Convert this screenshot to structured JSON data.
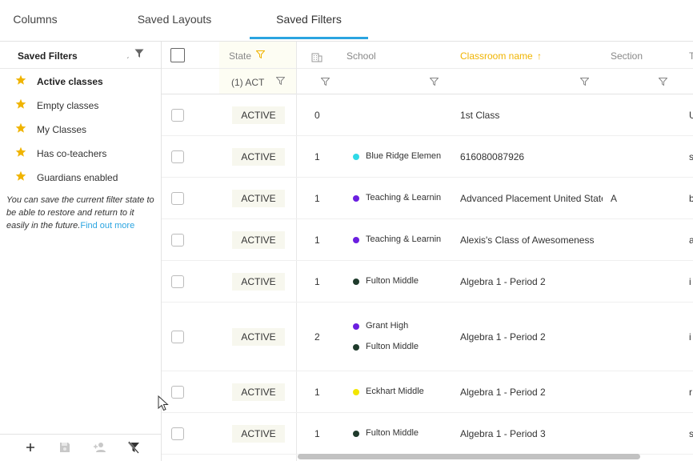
{
  "tabs": [
    {
      "label": "Columns",
      "active": false
    },
    {
      "label": "Saved Layouts",
      "active": false
    },
    {
      "label": "Saved Filters",
      "active": true
    }
  ],
  "sidebar": {
    "title": "Saved Filters",
    "items": [
      {
        "label": "Active classes",
        "bold": true
      },
      {
        "label": "Empty classes",
        "bold": false
      },
      {
        "label": "My Classes",
        "bold": false
      },
      {
        "label": "Has co-teachers",
        "bold": false
      },
      {
        "label": "Guardians enabled",
        "bold": false
      }
    ],
    "help_text": "You can save the current filter state to be able to restore and return to it easily in the future.",
    "help_link": "Find out more",
    "footer_icons": [
      "add-icon",
      "save-icon",
      "add-user-icon",
      "clear-filter-icon"
    ]
  },
  "grid": {
    "headers": {
      "state": "State",
      "school": "School",
      "classroom": "Classroom name",
      "section": "Section",
      "next": "T"
    },
    "state_filter_value": "(1) ACT",
    "accent_color": "#f0b400",
    "rows": [
      {
        "state": "ACTIVE",
        "count": "0",
        "schools": [],
        "classroom": "1st Class",
        "section": "",
        "next": "U"
      },
      {
        "state": "ACTIVE",
        "count": "1",
        "schools": [
          {
            "name": "Blue Ridge Elementa",
            "color": "#2fd9e6"
          }
        ],
        "classroom": "616080087926",
        "section": "",
        "next": "s"
      },
      {
        "state": "ACTIVE",
        "count": "1",
        "schools": [
          {
            "name": "Teaching & Learning",
            "color": "#6b1fe0"
          }
        ],
        "classroom": "Advanced Placement United State",
        "section": "A",
        "next": "b"
      },
      {
        "state": "ACTIVE",
        "count": "1",
        "schools": [
          {
            "name": "Teaching & Learning",
            "color": "#6b1fe0"
          }
        ],
        "classroom": "Alexis's Class of Awesomeness",
        "section": "",
        "next": "a"
      },
      {
        "state": "ACTIVE",
        "count": "1",
        "schools": [
          {
            "name": "Fulton Middle",
            "color": "#1f3b2c"
          }
        ],
        "classroom": "Algebra 1 - Period 2",
        "section": "",
        "next": "i"
      },
      {
        "state": "ACTIVE",
        "count": "2",
        "schools": [
          {
            "name": "Grant High",
            "color": "#6b1fe0"
          },
          {
            "name": "Fulton Middle",
            "color": "#1f3b2c"
          }
        ],
        "classroom": "Algebra 1 - Period 2",
        "section": "",
        "next": "i"
      },
      {
        "state": "ACTIVE",
        "count": "1",
        "schools": [
          {
            "name": "Eckhart Middle",
            "color": "#f2e600"
          }
        ],
        "classroom": "Algebra 1 - Period 2",
        "section": "",
        "next": "r"
      },
      {
        "state": "ACTIVE",
        "count": "1",
        "schools": [
          {
            "name": "Fulton Middle",
            "color": "#1f3b2c"
          }
        ],
        "classroom": "Algebra 1 - Period 3",
        "section": "",
        "next": "s"
      }
    ]
  }
}
